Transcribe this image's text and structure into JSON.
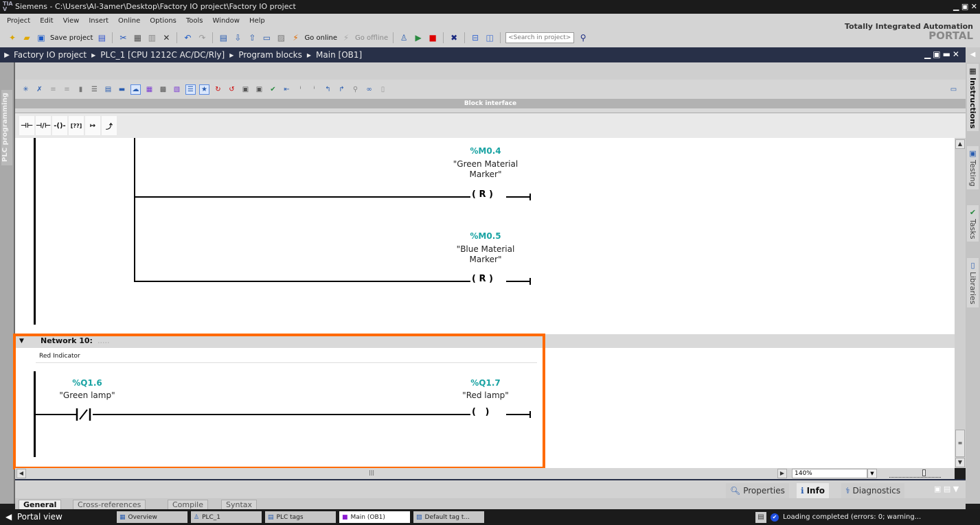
{
  "window": {
    "title": "Siemens  -  C:\\Users\\Al-3amer\\Desktop\\Factory IO project\\Factory IO project",
    "app_icon": "TIA",
    "controls": "_ ▫ ✕"
  },
  "menu": [
    "Project",
    "Edit",
    "View",
    "Insert",
    "Online",
    "Options",
    "Tools",
    "Window",
    "Help"
  ],
  "toolbar": {
    "save_label": "Save project",
    "go_online_label": "Go online",
    "go_offline_label": "Go offline",
    "search_placeholder": "<Search in project>"
  },
  "brand": {
    "line1": "Totally Integrated Automation",
    "line2": "PORTAL"
  },
  "breadcrumb": [
    "Factory IO project",
    "PLC_1 [CPU 1212C AC/DC/Rly]",
    "Program blocks",
    "Main [OB1]"
  ],
  "left_panel": {
    "label": "PLC programming"
  },
  "block_interface": {
    "label": "Block interface"
  },
  "ladder_palette": [
    "-| |-",
    "-|/|-",
    "-( )-",
    "??",
    "↦",
    "⤴"
  ],
  "network9": {
    "coils": [
      {
        "address": "%M0.4",
        "symbol": "\"Green Material Marker\"",
        "symbol_l1": "\"Green Material",
        "symbol_l2": "Marker\"",
        "type": "R"
      },
      {
        "address": "%M0.5",
        "symbol": "\"Blue Material Marker\"",
        "symbol_l1": "\"Blue Material",
        "symbol_l2": "Marker\"",
        "type": "R"
      }
    ]
  },
  "network10": {
    "title": "Network 10:",
    "title_dots": ".....",
    "comment": "Red Indicator",
    "contact": {
      "address": "%Q1.6",
      "symbol": "\"Green lamp\"",
      "type": "normally-closed"
    },
    "coil": {
      "address": "%Q1.7",
      "symbol": "\"Red lamp\"",
      "type": "output"
    }
  },
  "right_tabs": [
    "Instructions",
    "Testing",
    "Tasks",
    "Libraries"
  ],
  "zoom": {
    "value": "140%"
  },
  "inspector_tabs": [
    "Properties",
    "Info",
    "Diagnostics"
  ],
  "inspector_active": "Info",
  "sub_tabs": [
    "General",
    "Cross-references",
    "Compile",
    "Syntax"
  ],
  "sub_active": "General",
  "taskbar": {
    "portal_view": "Portal view",
    "items": [
      "Overview",
      "PLC_1",
      "PLC tags",
      "Main (OB1)",
      "Default tag t..."
    ],
    "active": "Main (OB1)",
    "status": "Loading completed (errors: 0; warning..."
  },
  "colors": {
    "highlight": "#ff6a00",
    "address": "#1aa3a3",
    "breadcrumb_bg": "#283048"
  }
}
